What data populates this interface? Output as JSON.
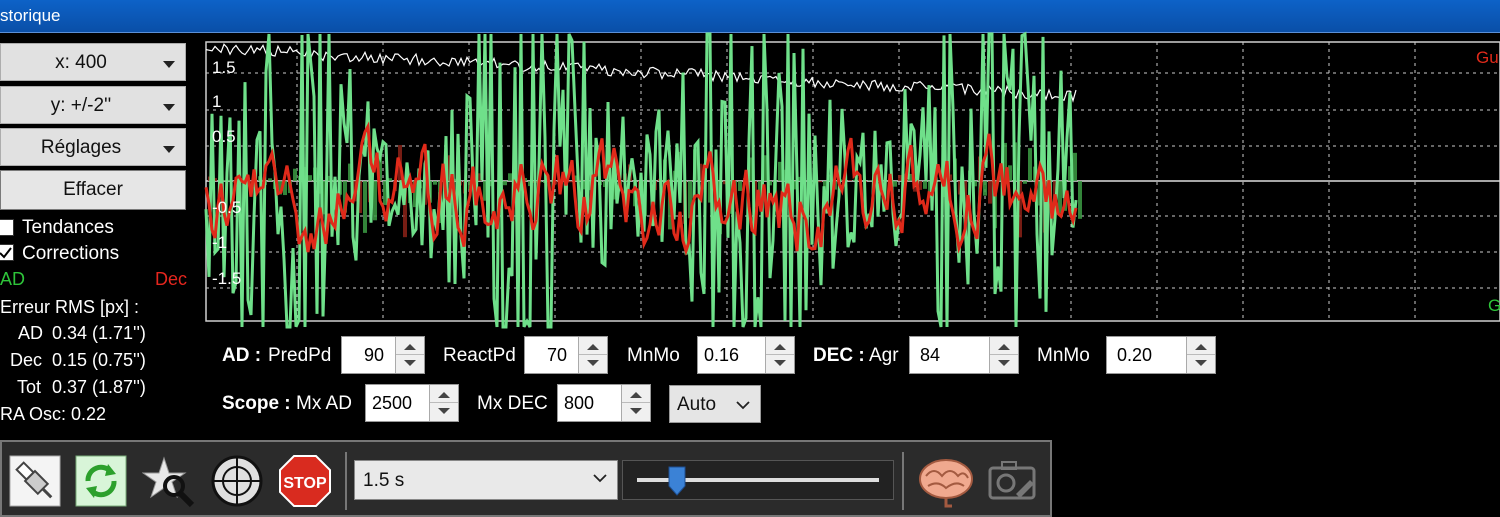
{
  "window": {
    "title": "storique"
  },
  "controls": {
    "x_scale": "x: 400",
    "y_scale": "y: +/-2''",
    "settings": "Réglages",
    "clear": "Effacer",
    "trends_label": "Tendances",
    "trends_checked": false,
    "corrections_label": "Corrections",
    "corrections_checked": true,
    "ra_legend": "AD",
    "dec_legend": "Dec"
  },
  "stats": {
    "title": "Erreur RMS [px] :",
    "ad_label": "AD",
    "ad_value": "0.34 (1.71'')",
    "dec_label": "Dec",
    "dec_value": "0.15 (0.75'')",
    "tot_label": "Tot",
    "tot_value": "0.37 (1.87'')",
    "ra_osc": "RA Osc: 0.22"
  },
  "graph": {
    "y_ticks": [
      "1.5",
      "1",
      "0.5",
      "-0.5",
      "-1",
      "-1.5"
    ],
    "right_label_top": "Gu",
    "right_label_bottom": "G",
    "colors": {
      "ra": "#6fe08a",
      "dec": "#e02a1a",
      "snr": "#ffffff",
      "grid": "#cccccc"
    }
  },
  "params": {
    "ad_label": "AD :",
    "predpd_label": "PredPd",
    "predpd_value": "90",
    "reactpd_label": "ReactPd",
    "reactpd_value": "70",
    "mnmo_ad_label": "MnMo",
    "mnmo_ad_value": "0.16",
    "dec_label": "DEC :",
    "agr_label": "Agr",
    "agr_value": "84",
    "mnmo_dec_label": "MnMo",
    "mnmo_dec_value": "0.20",
    "scope_label": "Scope :",
    "mxad_label": "Mx AD",
    "mxad_value": "2500",
    "mxdec_label": "Mx DEC",
    "mxdec_value": "800",
    "auto_value": "Auto"
  },
  "toolbar": {
    "exposure_value": "1.5 s",
    "stop_label": "STOP",
    "icons": [
      "usb-plug-icon",
      "loop-icon",
      "star-search-icon",
      "crosshair-icon",
      "stop-icon",
      "brain-icon",
      "camera-settings-icon"
    ]
  }
}
